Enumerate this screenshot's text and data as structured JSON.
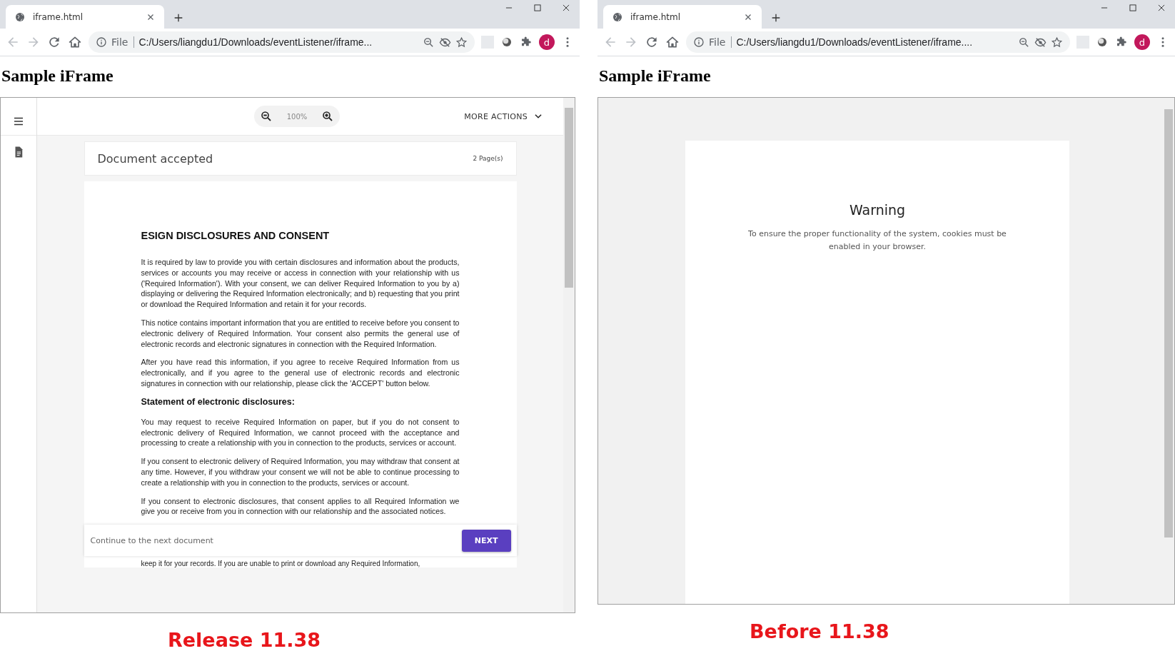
{
  "panels": [
    {
      "kind": "viewer",
      "browser": {
        "tab_title": "iframe.html",
        "nav": [
          {
            "kind": "back",
            "disabled": true
          },
          {
            "kind": "forward",
            "disabled": true
          },
          {
            "kind": "reload",
            "disabled": false
          },
          {
            "kind": "home",
            "disabled": false
          }
        ],
        "scheme_label": "File",
        "url": "C:/Users/liangdu1/Downloads/eventListener/iframe...",
        "avatar_letter": "d"
      },
      "page_heading": "Sample iFrame",
      "viewer": {
        "zoom_label": "100%",
        "more_actions": "MORE ACTIONS",
        "document_status": "Document accepted",
        "page_count": "2 Page(s)",
        "sections": [
          {
            "kind": "title",
            "text": "ESIGN DISCLOSURES AND CONSENT"
          },
          {
            "kind": "paragraph",
            "text": "It is required by law to provide you with certain disclosures and information about the products, services or accounts you may receive or access in connection with your relationship with us ('Required Information'). With your consent, we can deliver Required Information to you by a) displaying or delivering the Required Information electronically; and b) requesting that you print or download the Required Information and retain it for your records."
          },
          {
            "kind": "paragraph",
            "text": "This notice contains important information that you are entitled to receive before you consent to electronic delivery of Required Information. Your consent also permits the general use of electronic records and electronic signatures in connection with the Required Information."
          },
          {
            "kind": "paragraph",
            "text": "After you have read this information, if you agree to receive Required Information from us electronically, and if you agree to the general use of electronic records and electronic signatures in connection with our relationship, please click the 'ACCEPT' button below."
          },
          {
            "kind": "heading",
            "text": "Statement of electronic disclosures:"
          },
          {
            "kind": "paragraph",
            "text": "You may request to receive Required Information on paper, but if you do not consent to electronic delivery of Required Information, we cannot proceed with the acceptance and processing to create a relationship with you in connection to the products, services or account."
          },
          {
            "kind": "paragraph",
            "text": "If you consent to electronic delivery of Required Information, you may withdraw that consent at any time. However, if you withdraw your consent we will not be able to continue processing to create a relationship with you in connection to the products, services or account."
          },
          {
            "kind": "paragraph",
            "text": "If you consent to electronic disclosures, that consent applies to all Required Information we give you or receive from you in connection with our relationship and the associated notices."
          }
        ],
        "footer_hint": "Continue to the next document",
        "next_button": "NEXT",
        "tail_line": "keep it for your records. If you are unable to print or download any Required Information,"
      },
      "caption": "Release 11.38"
    },
    {
      "kind": "warning",
      "browser": {
        "tab_title": "iframe.html",
        "nav": [
          {
            "kind": "back",
            "disabled": true
          },
          {
            "kind": "forward",
            "disabled": true
          },
          {
            "kind": "reload",
            "disabled": false
          },
          {
            "kind": "home",
            "disabled": false
          }
        ],
        "scheme_label": "File",
        "url": "C:/Users/liangdu1/Downloads/eventListener/iframe....",
        "avatar_letter": "d"
      },
      "page_heading": "Sample iFrame",
      "warning": {
        "title": "Warning",
        "message": "To ensure the proper functionality of the system, cookies must be enabled in your browser."
      },
      "caption": "Before 11.38"
    }
  ]
}
